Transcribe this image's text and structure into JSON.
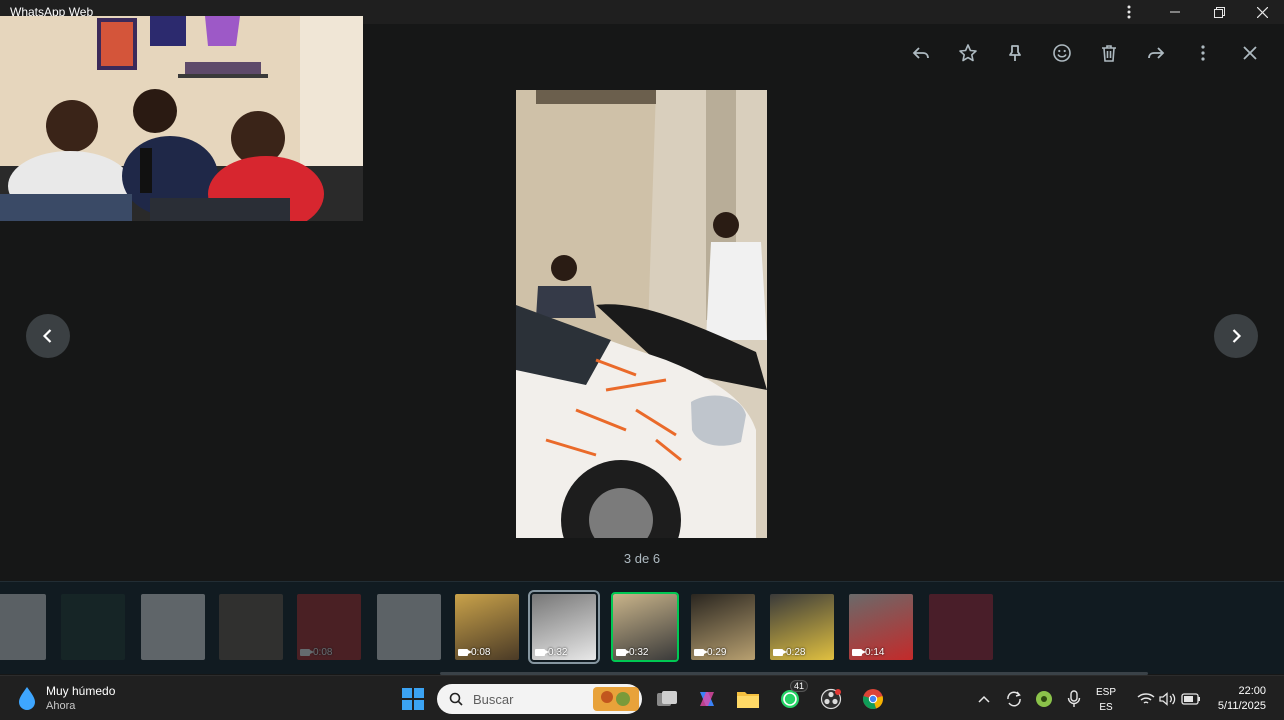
{
  "window": {
    "title": "WhatsApp Web",
    "menu_icon": "more-vertical-icon",
    "minimize_icon": "minimize-icon",
    "restore_icon": "restore-icon",
    "close_icon": "close-icon"
  },
  "viewer": {
    "toolbar_icons": [
      "reply-icon",
      "star-icon",
      "pin-icon",
      "emoji-icon",
      "delete-icon",
      "forward-icon",
      "more-vertical-icon",
      "close-icon"
    ],
    "counter": "3 de 6",
    "prev_icon": "chevron-left-icon",
    "next_icon": "chevron-right-icon"
  },
  "thumbnails": [
    {
      "kind": "doc",
      "duration": "",
      "faded": true
    },
    {
      "kind": "screen",
      "duration": "",
      "faded": true
    },
    {
      "kind": "doc2",
      "duration": "",
      "faded": true
    },
    {
      "kind": "dark",
      "duration": "",
      "faded": true
    },
    {
      "kind": "car-red",
      "duration": "0:08",
      "faded": true
    },
    {
      "kind": "doc",
      "duration": "",
      "faded": true
    },
    {
      "kind": "video",
      "duration": "0:08",
      "faded": false
    },
    {
      "kind": "video-white",
      "duration": "0:32",
      "faded": false,
      "selected": true
    },
    {
      "kind": "video-car",
      "duration": "0:32",
      "faded": false,
      "current": true
    },
    {
      "kind": "video-night",
      "duration": "0:29",
      "faded": false
    },
    {
      "kind": "video-yellow",
      "duration": "0:28",
      "faded": false
    },
    {
      "kind": "video-helmet",
      "duration": "0:14",
      "faded": false
    },
    {
      "kind": "sticker",
      "duration": "",
      "faded": true
    }
  ],
  "taskbar": {
    "weather_title": "Muy húmedo",
    "weather_sub": "Ahora",
    "search_placeholder": "Buscar",
    "whatsapp_badge": "41",
    "lang_top": "ESP",
    "lang_bottom": "ES",
    "time": "22:00",
    "date": "5/11/2025"
  },
  "colors": {
    "background": "#161717",
    "strip": "#111b21",
    "accent_green": "#00c853",
    "taskbar": "#202020"
  }
}
